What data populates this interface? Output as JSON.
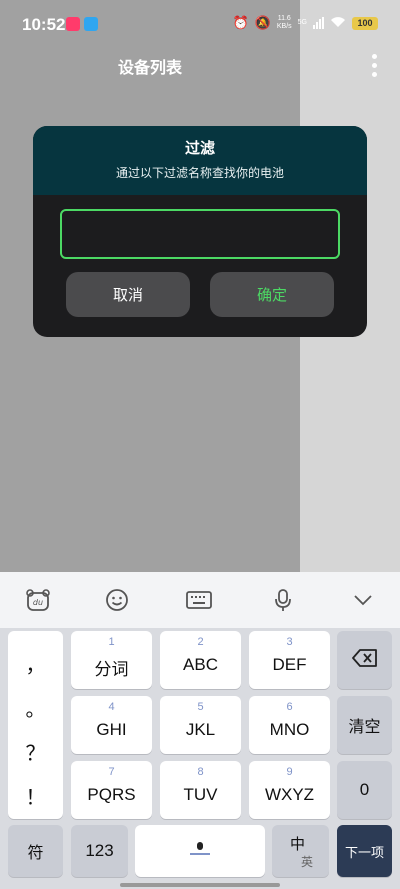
{
  "status": {
    "time": "10:52",
    "app_icon_a": "uu",
    "net_speed_value": "11.6",
    "net_speed_unit": "KB/s",
    "net_type": "5G",
    "battery": "100"
  },
  "header": {
    "title": "设备列表"
  },
  "dialog": {
    "title": "过滤",
    "subtitle": "通过以下过滤名称查找你的电池",
    "input_value": "",
    "cancel_label": "取消",
    "ok_label": "确定",
    "accent_color": "#4cd964"
  },
  "keyboard": {
    "symbols": [
      "，",
      "。",
      "？",
      "！"
    ],
    "keys": [
      {
        "num": "1",
        "label": "分词"
      },
      {
        "num": "2",
        "label": "ABC"
      },
      {
        "num": "3",
        "label": "DEF"
      },
      {
        "num": "4",
        "label": "GHI"
      },
      {
        "num": "5",
        "label": "JKL"
      },
      {
        "num": "6",
        "label": "MNO"
      },
      {
        "num": "7",
        "label": "PQRS"
      },
      {
        "num": "8",
        "label": "TUV"
      },
      {
        "num": "9",
        "label": "WXYZ"
      }
    ],
    "clear_label": "清空",
    "zero_label": "0",
    "symbol_key": "符",
    "num_key": "123",
    "lang_key_top": "中",
    "lang_key_bottom": "英",
    "next_key": "下一项"
  }
}
